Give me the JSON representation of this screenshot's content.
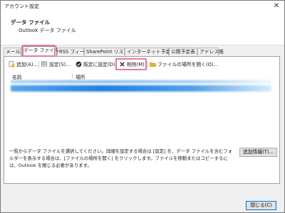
{
  "window": {
    "title": "アカウント設定",
    "close_glyph": "✕"
  },
  "header": {
    "title": "データ ファイル",
    "subtitle": "Outlook データ ファイル"
  },
  "tabs": [
    {
      "label": "メール"
    },
    {
      "label": "データ ファイル",
      "active": true
    },
    {
      "label": "RSS フィード"
    },
    {
      "label": "SharePoint リスト"
    },
    {
      "label": "インターネット予定表"
    },
    {
      "label": "公開予定表"
    },
    {
      "label": "アドレス帳"
    }
  ],
  "toolbar": {
    "add": {
      "label": "追加(A)...",
      "icon": "add-file-icon"
    },
    "settings": {
      "label": "設定(S)...",
      "icon": "settings-icon"
    },
    "default": {
      "label": "既定に設定(D)",
      "icon": "check-circle-icon"
    },
    "remove": {
      "label": "削除(M)",
      "icon": "remove-x-icon"
    },
    "open_location": {
      "label": "ファイルの場所を開く(O)...",
      "icon": "folder-icon"
    }
  },
  "list": {
    "columns": [
      "名前",
      "場所"
    ]
  },
  "description": "一覧からデータ ファイルを選択してください。詳細を設定する場合は [設定] を、データ ファイルを含むフォルダーを表示する場合は、[ファイルの場所を開く] をクリックします。ファイルを移動またはコピーするには、Outlook を閉じる必要があります。",
  "buttons": {
    "add_info": "追加情報(T)...",
    "close": "閉じる(C)"
  },
  "colors": {
    "highlight": "#e779a6",
    "selection": "#1d7ee0"
  }
}
